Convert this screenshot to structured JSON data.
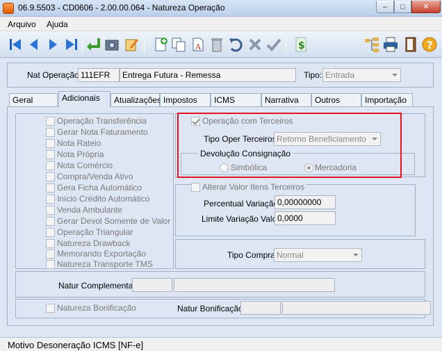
{
  "window": {
    "title": "06.9.5503 - CD0606 - 2.00.00.064 - Natureza Operação",
    "minimize": "–",
    "maximize": "□",
    "close": "✕"
  },
  "menu": {
    "items": [
      "Arquivo",
      "Ajuda"
    ]
  },
  "toolbar": {
    "icons": [
      "first-icon",
      "previous-icon",
      "next-icon",
      "last-icon",
      "return-icon",
      "camera-icon",
      "edit-icon",
      "new-icon",
      "copy-icon",
      "rename-icon",
      "delete-icon",
      "undo-icon",
      "cancel-icon",
      "confirm-icon",
      "money-icon",
      "tree-icon",
      "print-icon",
      "exit-icon",
      "help-icon"
    ]
  },
  "header": {
    "nat_label": "Nat Operação:",
    "nat_code": "111EFR",
    "nat_desc": "Entrega Futura - Remessa",
    "tipo_label": "Tipo:",
    "tipo_value": "Entrada"
  },
  "tabs": [
    "Geral",
    "Adicionais",
    "Atualizações",
    "Impostos",
    "ICMS",
    "Narrativa",
    "Outros",
    "Importação"
  ],
  "active_tab": "Adicionais",
  "left_checks": [
    "Operação Transferência",
    "Gerar Nota Faturamento",
    "Nota Rateio",
    "Nota Própria",
    "Nota Comércio",
    "Compra/Venda Ativo",
    "Gera Ficha Automático",
    "Início Crédito Automático",
    "Venda Ambulante",
    "Gerar Devol Somente de Valor",
    "Operação Triangular",
    "Natureza Drawback",
    "Memorando Exportação",
    "Natureza Transporte TMS"
  ],
  "terceiros": {
    "check_label": "Operação com Terceiros",
    "tipo_label": "Tipo Oper Terceiros:",
    "tipo_value": "Retorno Beneficiamento",
    "devol_title": "Devolução Consignação",
    "radio_simbolica": "Simbólica",
    "radio_mercadoria": "Mercadoria"
  },
  "valor": {
    "check_label": "Alterar Valor Itens Terceiros",
    "perc_label": "Percentual Variação:",
    "perc_value": "0,00000000",
    "limite_label": "Limite Variação Valor:",
    "limite_value": "0,0000"
  },
  "compra": {
    "label": "Tipo Compra:",
    "value": "Normal"
  },
  "complementar": {
    "label": "Natur Complementar:"
  },
  "bonificacao": {
    "check_label": "Natureza Bonificação",
    "label": "Natur Bonificação:"
  },
  "status": "Motivo Desoneração ICMS [NF-e]"
}
